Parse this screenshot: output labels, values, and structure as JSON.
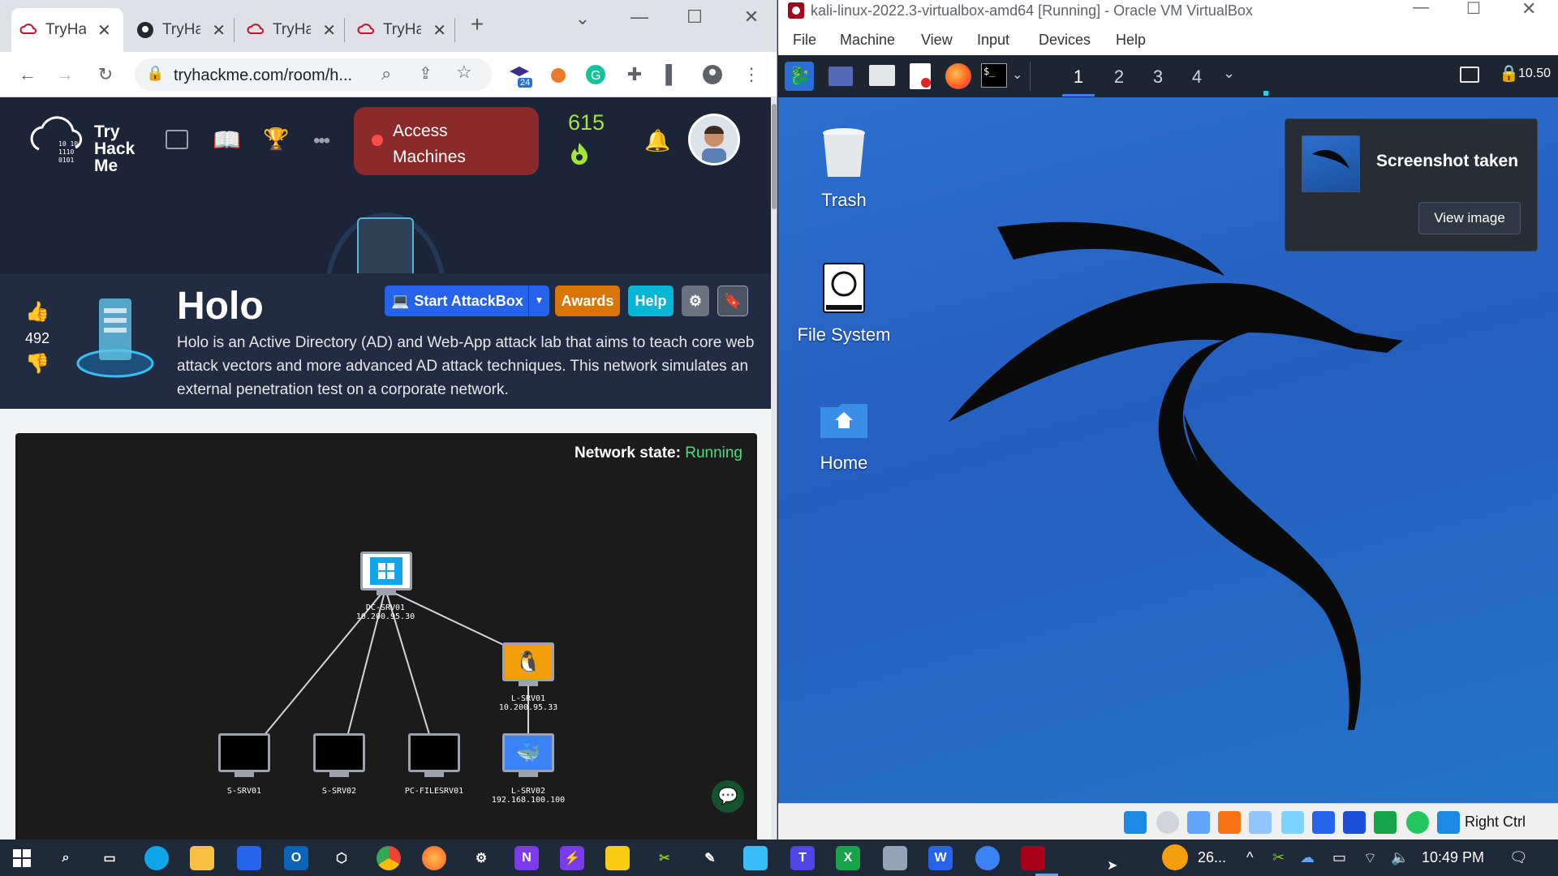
{
  "browser": {
    "tabs": [
      {
        "label": "TryHa",
        "favicon": "tryhackme-cloud-icon"
      },
      {
        "label": "TryHa",
        "favicon": "github-icon"
      },
      {
        "label": "TryHa",
        "favicon": "tryhackme-cloud-icon"
      },
      {
        "label": "TryHa",
        "favicon": "tryhackme-cloud-icon"
      }
    ],
    "url": "tryhackme.com/room/h...",
    "extension_badge": "24"
  },
  "thm": {
    "logo_text": [
      "Try",
      "Hack",
      "Me"
    ],
    "access_machines": "Access Machines",
    "streak": "615",
    "room_title": "Holo",
    "room_description": "Holo is an Active Directory (AD) and Web-App attack lab that aims to teach core web attack vectors and more advanced AD attack techniques. This network simulates an external penetration test on a corporate network.",
    "votes": "492",
    "buttons": {
      "start_attackbox": "Start AttackBox",
      "awards": "Awards",
      "help": "Help"
    },
    "network": {
      "state_label": "Network state:",
      "state_value": "Running",
      "nodes": [
        {
          "name": "DC-SRV01",
          "ip": "10.200.95.30",
          "os": "windows"
        },
        {
          "name": "L-SRV01",
          "ip": "10.200.95.33",
          "os": "linux"
        },
        {
          "name": "S-SRV01",
          "ip": "",
          "os": "unknown"
        },
        {
          "name": "S-SRV02",
          "ip": "",
          "os": "unknown"
        },
        {
          "name": "PC-FILESRV01",
          "ip": "",
          "os": "unknown"
        },
        {
          "name": "L-SRV02",
          "ip": "192.168.100.100",
          "os": "docker"
        }
      ]
    },
    "colors": {
      "nav_bg": "#1c2538",
      "access_bg": "#8a2a2b",
      "running": "#4ade80",
      "start_btn": "#2563eb",
      "awards_btn": "#d97706",
      "help_btn": "#06b6d4"
    }
  },
  "vbox": {
    "title": "kali-linux-2022.3-virtualbox-amd64 [Running] - Oracle VM VirtualBox",
    "menu": [
      "File",
      "Machine",
      "View",
      "Input",
      "Devices",
      "Help"
    ],
    "workspaces": [
      "1",
      "2",
      "3",
      "4"
    ],
    "panel_right_text": "10.50",
    "desktop_icons": [
      "Trash",
      "File System",
      "Home"
    ],
    "notification": {
      "title": "Screenshot taken",
      "button": "View image"
    },
    "host_key": "Right Ctrl"
  },
  "taskbar": {
    "weather": "26...",
    "clock": "10:49 PM"
  }
}
